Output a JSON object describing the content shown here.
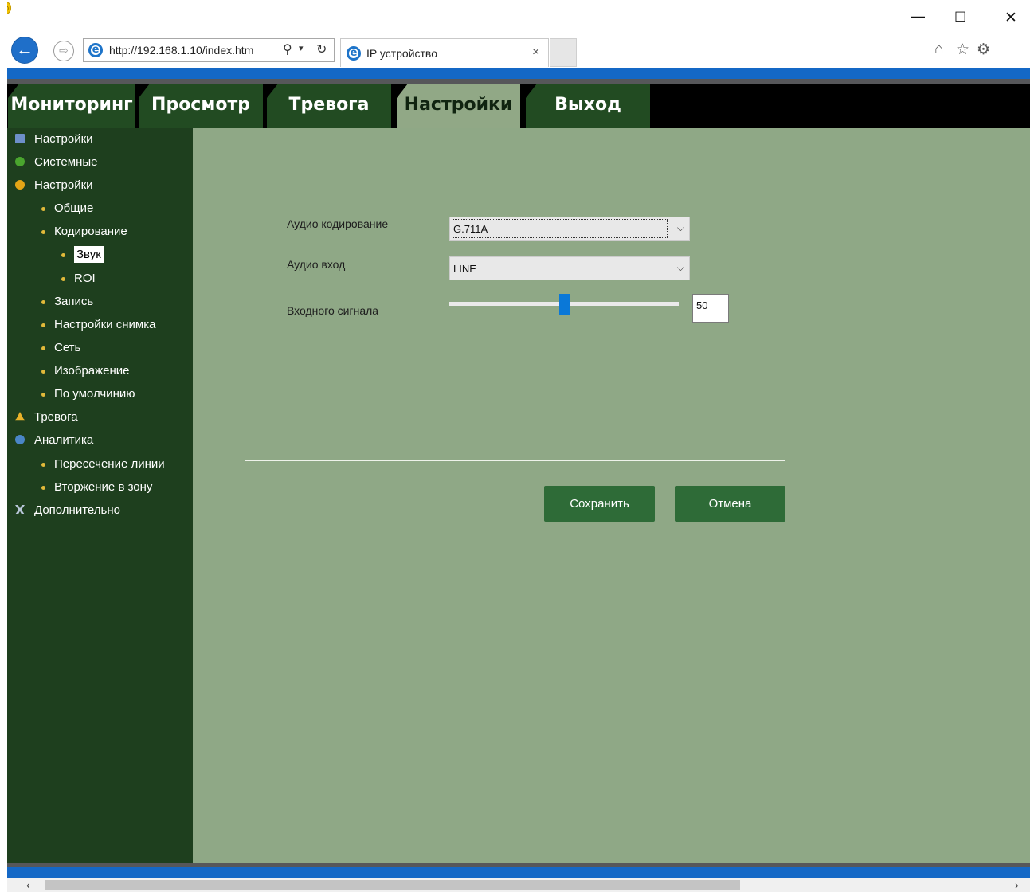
{
  "browser": {
    "url": "http://192.168.1.10/index.htm",
    "tab_title": "IP устройство",
    "back_glyph": "←",
    "forward_glyph": "⇨",
    "search_glyph": "⚲",
    "dropdown_glyph": "▾",
    "refresh_glyph": "↻",
    "close_tab_glyph": "×",
    "minimize_glyph": "—",
    "maximize_glyph": "☐",
    "close_glyph": "✕",
    "home_glyph": "⌂",
    "favorites_glyph": "☆",
    "tools_glyph": "⚙",
    "smiley_glyph": "☺",
    "icons": [
      "back-arrow-icon",
      "forward-arrow-icon",
      "ie-logo-icon",
      "search-icon",
      "refresh-icon",
      "home-icon",
      "favorites-star-icon",
      "gear-icon",
      "smiley-feedback-icon"
    ]
  },
  "nav": {
    "tabs": [
      {
        "label": "Мониторинг",
        "active": false
      },
      {
        "label": "Просмотр",
        "active": false
      },
      {
        "label": "Тревога",
        "active": false
      },
      {
        "label": "Настройки",
        "active": true
      },
      {
        "label": "Выход",
        "active": false
      }
    ]
  },
  "sidebar": {
    "items": [
      {
        "label": "Настройки",
        "icon": "monitor-icon"
      },
      {
        "label": "Системные",
        "icon": "info-icon"
      },
      {
        "label": "Настройки",
        "icon": "gear-icon"
      },
      {
        "label": "Общие"
      },
      {
        "label": "Кодирование"
      },
      {
        "label": "Звук",
        "selected": true
      },
      {
        "label": "ROI"
      },
      {
        "label": "Запись"
      },
      {
        "label": "Настройки снимка"
      },
      {
        "label": "Сеть"
      },
      {
        "label": "Изображение"
      },
      {
        "label": "По умолчинию"
      },
      {
        "label": "Тревога",
        "icon": "bell-icon"
      },
      {
        "label": "Аналитика",
        "icon": "analytics-icon"
      },
      {
        "label": "Пересечение линии"
      },
      {
        "label": "Вторжение в зону"
      },
      {
        "label": "Дополнительно",
        "icon": "tools-icon"
      }
    ]
  },
  "form": {
    "audio_coding_label": "Аудио кодирование",
    "audio_coding_value": "G.711A",
    "audio_input_label": "Аудио вход",
    "audio_input_value": "LINE",
    "input_level_label": "Входного сигнала",
    "input_level_value": "50",
    "input_level_fraction": 0.5,
    "chevron_glyph": "⌵"
  },
  "buttons": {
    "save": "Сохранить",
    "cancel": "Отмена"
  },
  "scroll": {
    "left_glyph": "‹",
    "right_glyph": "›"
  },
  "colors": {
    "nav_tab": "#224b22",
    "nav_tab_active": "#91a886",
    "sidebar": "#1e3f1e",
    "content": "#8fa886",
    "button": "#2e6b37",
    "slider_thumb": "#0a78d8",
    "chrome_blue": "#1468c6"
  }
}
